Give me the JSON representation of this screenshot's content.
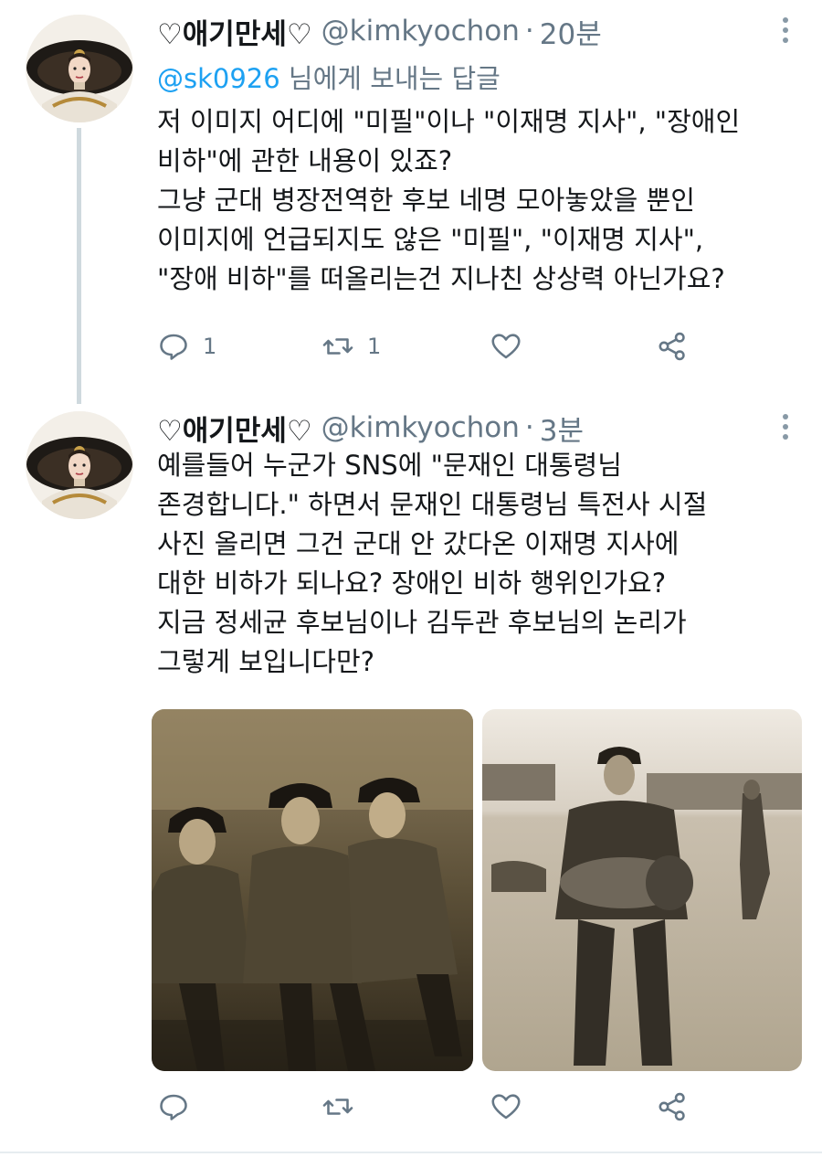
{
  "tweets": [
    {
      "name": "♡애기만세♡",
      "handle": "@kimkyochon",
      "time": "20분",
      "reply_prefix": "@sk0926",
      "reply_suffix": " 님에게 보내는 답글",
      "lines": [
        "저 이미지 어디에 \"미필\"이나 \"이재명 지사\", \"장애인",
        "비하\"에 관한 내용이 있죠?",
        "그냥 군대 병장전역한 후보 네명 모아놓았을 뿐인",
        "이미지에 언급되지도 않은 \"미필\", \"이재명 지사\",",
        "\"장애 비하\"를 떠올리는건 지나친 상상력 아닌가요?"
      ],
      "reply_count": "1",
      "retweet_count": "1"
    },
    {
      "name": "♡애기만세♡",
      "handle": "@kimkyochon",
      "time": "3분",
      "lines": [
        "예를들어 누군가 SNS에 \"문재인 대통령님",
        "존경합니다.\" 하면서 문재인 대통령님 특전사 시절",
        "사진 올리면 그건 군대 안 갔다온 이재명 지사에",
        "대한 비하가 되나요? 장애인 비하 행위인가요?",
        "지금 정세균 후보님이나 김두관 후보님의 논리가",
        "그렇게 보입니다만?"
      ]
    }
  ],
  "icons": {
    "more": "more-vertical-icon",
    "reply": "reply-icon",
    "retweet": "retweet-icon",
    "like": "heart-icon",
    "share": "share-icon"
  },
  "colors": {
    "accent": "#1da1f2",
    "secondary_text": "#657786",
    "icon": "#657786",
    "thread_line": "#cfd9de"
  }
}
